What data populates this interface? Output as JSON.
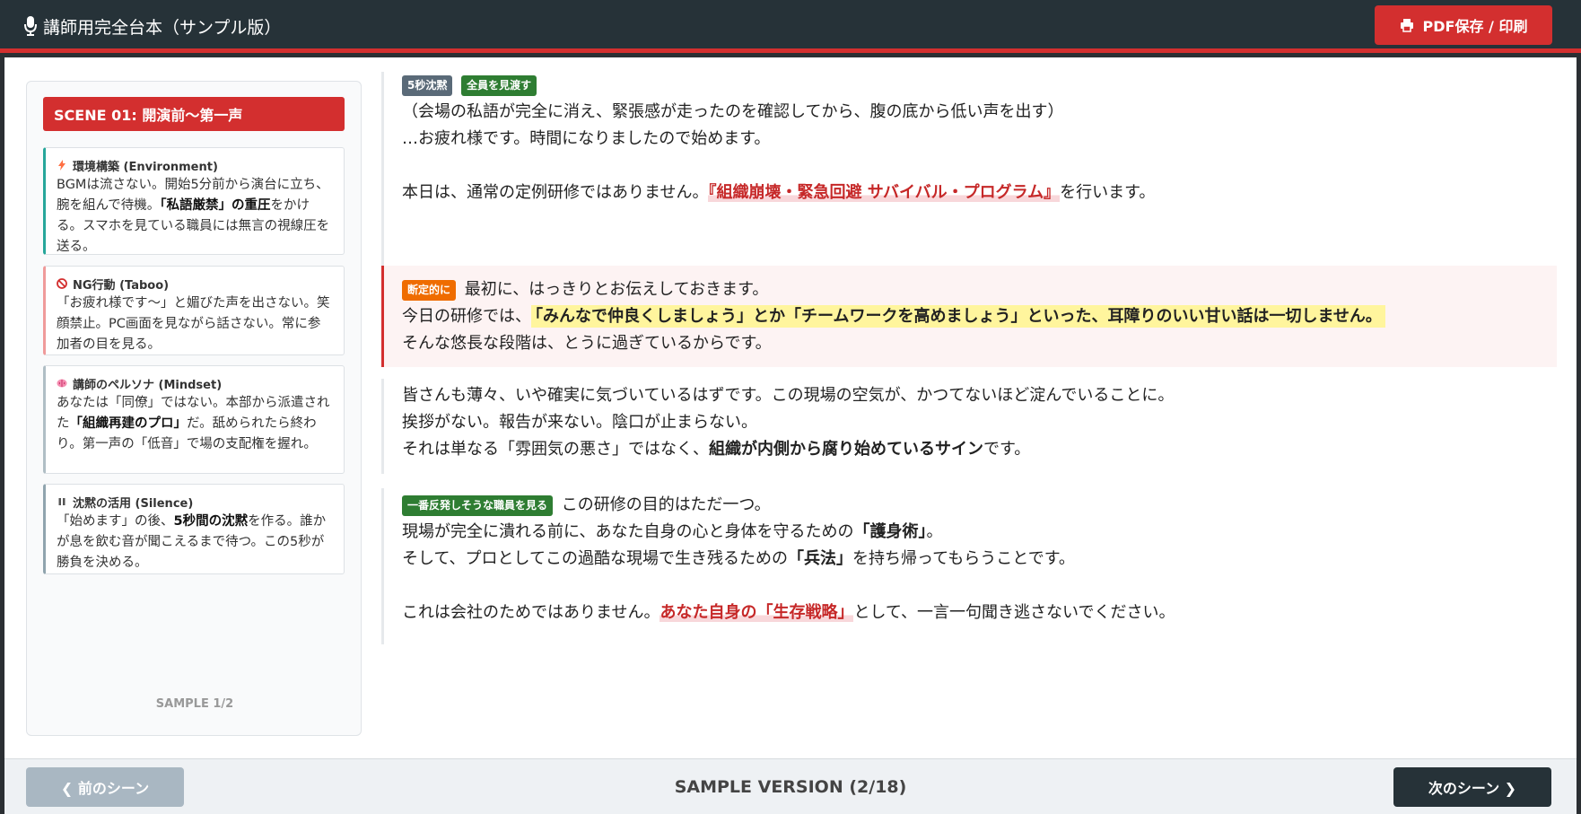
{
  "header": {
    "title": "講師用完全台本（サンプル版）",
    "title_icon": "microphone-icon",
    "pdf_button": "PDF保存 / 印刷",
    "pdf_icon": "printer-icon"
  },
  "sidebar": {
    "scene_title": "SCENE 01: 開演前〜第一声",
    "cards": [
      {
        "icon": "lightning-icon",
        "title": "環境構築 (Environment)",
        "body_1": "BGMは流さない。開始5分前から演台に立ち、腕を組んで待機。",
        "body_bold": "「私語厳禁」の重圧",
        "body_2": "をかける。スマホを見ている職員には無言の視線圧を送る。"
      },
      {
        "icon": "prohibited-icon",
        "title": "NG行動 (Taboo)",
        "body_1": "「お疲れ様です〜」と媚びた声を出さない。笑顔禁止。PC画面を見ながら話さない。常に参加者の目を見る。"
      },
      {
        "icon": "brain-icon",
        "title": "講師のペルソナ (Mindset)",
        "body_1": "あなたは「同僚」ではない。本部から派遣された",
        "body_bold": "「組織再建のプロ」",
        "body_2": "だ。舐められたら終わり。第一声の「低音」で場の支配権を握れ。"
      },
      {
        "icon": "pause-icon",
        "title": "沈黙の活用 (Silence)",
        "body_1": "「始めます」の後、",
        "body_bold": "5秒間の沈黙",
        "body_2": "を作る。誰かが息を飲む音が聞こえるまで待つ。この5秒が勝負を決める。"
      }
    ],
    "sample_count": "SAMPLE 1/2"
  },
  "script": {
    "block1": {
      "tag1": "5秒沈黙",
      "tag2": "全員を見渡す",
      "line1": "（会場の私語が完全に消え、緊張感が走ったのを確認してから、腹の底から低い声を出す）",
      "line2": "…お疲れ様です。時間になりましたので始めます。",
      "line3_a": "本日は、通常の定例研修ではありません。",
      "line3_emph": "『組織崩壊・緊急回避 サバイバル・プログラム』",
      "line3_b": "を行います。"
    },
    "block2": {
      "tag": "断定的に",
      "line1": "最初に、はっきりとお伝えしておきます。",
      "line2_a": "今日の研修では、",
      "line2_emph": "「みんなで仲良くしましょう」とか「チームワークを高めましょう」といった、耳障りのいい甘い話は一切しません。",
      "line3": "そんな悠長な段階は、とうに過ぎているからです。"
    },
    "block3": {
      "line1": "皆さんも薄々、いや確実に気づいているはずです。この現場の空気が、かつてないほど淀んでいることに。",
      "line2": "挨拶がない。報告が来ない。陰口が止まらない。",
      "line3_a": "それは単なる「雰囲気の悪さ」ではなく、",
      "line3_bold": "組織が内側から腐り始めているサイン",
      "line3_b": "です。"
    },
    "block4": {
      "tag": "一番反発しそうな職員を見る",
      "line1": "この研修の目的はただ一つ。",
      "line2_a": "現場が完全に潰れる前に、あなた自身の心と身体を守るための",
      "line2_bold": "「護身術」",
      "line2_b": "。",
      "line3_a": "そして、プロとしてこの過酷な現場で生き残るための",
      "line3_bold": "「兵法」",
      "line3_b": "を持ち帰ってもらうことです。",
      "line4_a": "これは会社のためではありません。",
      "line4_emph": "あなた自身の「生存戦略」",
      "line4_b": "として、一言一句聞き逃さないでください。"
    }
  },
  "footer": {
    "prev_button": "❮ 前のシーン",
    "label": "SAMPLE VERSION (2/18)",
    "next_button": "次のシーン ❯"
  },
  "colors": {
    "header_bg": "#263238",
    "accent_red": "#d32f2f",
    "tag_green": "#2e7d32",
    "tag_orange": "#ef6c00",
    "tag_grey": "#5a6a78",
    "highlight_yellow": "#fff59d"
  }
}
